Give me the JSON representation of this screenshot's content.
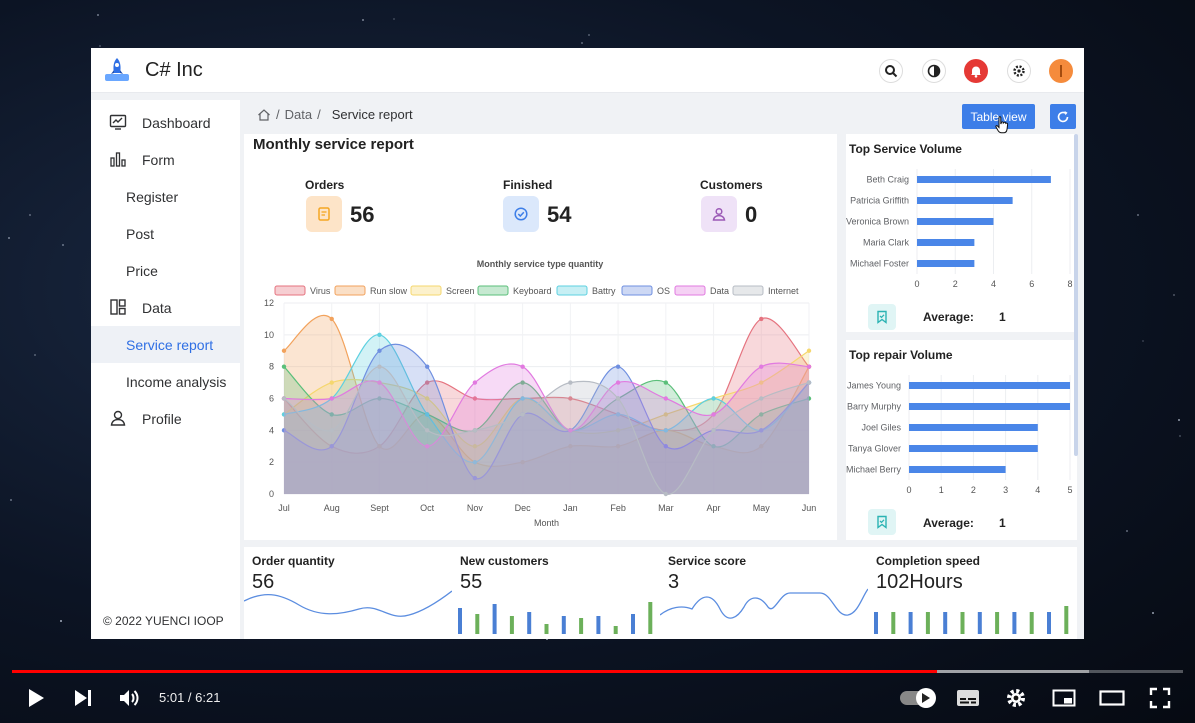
{
  "app": {
    "brand": "C# Inc",
    "accent": "#3d7ee8"
  },
  "topbar": {
    "icons": [
      "search-icon",
      "theme-toggle-icon",
      "notification-bell-icon",
      "gear-icon",
      "user-avatar"
    ]
  },
  "sidebar": {
    "items": [
      {
        "label": "Dashboard",
        "icon": "monitor-chart-icon"
      },
      {
        "label": "Form",
        "icon": "bar-chart-icon"
      },
      {
        "label": "Register"
      },
      {
        "label": "Post"
      },
      {
        "label": "Price"
      },
      {
        "label": "Data",
        "icon": "layout-grid-icon"
      },
      {
        "label": "Service report",
        "active": true
      },
      {
        "label": "Income analysis"
      },
      {
        "label": "Profile",
        "icon": "user-icon"
      }
    ],
    "copyright": "© 2022 YUENCI IOOP"
  },
  "breadcrumb": {
    "home_icon": "home-icon",
    "items": [
      "Data",
      "Service report"
    ]
  },
  "toolbar": {
    "table_view": "Table view",
    "refresh_icon": "refresh-icon"
  },
  "report": {
    "title": "Monthly service report",
    "kpis": [
      {
        "label": "Orders",
        "value": "56",
        "icon": "document-icon",
        "color": "#f5a623"
      },
      {
        "label": "Finished",
        "value": "54",
        "icon": "check-circle-icon",
        "color": "#3d7ee8"
      },
      {
        "label": "Customers",
        "value": "0",
        "icon": "user-icon",
        "color": "#9b59b6"
      }
    ]
  },
  "chart_data": [
    {
      "type": "area",
      "title": "Monthly service type quantity",
      "xlabel": "Month",
      "ylabel": "",
      "ylim": [
        0,
        12
      ],
      "yticks": [
        0,
        2,
        4,
        6,
        8,
        10,
        12
      ],
      "legend_position": "top",
      "categories": [
        "Jul",
        "Aug",
        "Sept",
        "Oct",
        "Nov",
        "Dec",
        "Jan",
        "Feb",
        "Mar",
        "Apr",
        "May",
        "Jun"
      ],
      "series": [
        {
          "name": "Virus",
          "color": "#e5737f",
          "values": [
            6,
            3,
            3,
            7,
            6,
            6,
            6,
            5,
            4,
            5,
            11,
            8
          ]
        },
        {
          "name": "Run slow",
          "color": "#f2a25c",
          "values": [
            9,
            11,
            3,
            5,
            2,
            2,
            3,
            3,
            4,
            3,
            3,
            8
          ]
        },
        {
          "name": "Screen",
          "color": "#f5d76e",
          "values": [
            5,
            7,
            7,
            6,
            3,
            6,
            4,
            4,
            5,
            6,
            7,
            9
          ]
        },
        {
          "name": "Keyboard",
          "color": "#5bbf7a",
          "values": [
            8,
            5,
            6,
            5,
            4,
            7,
            4,
            6,
            7,
            3,
            5,
            6
          ]
        },
        {
          "name": "Battry",
          "color": "#5ed0e0",
          "values": [
            5,
            6,
            10,
            5,
            2,
            6,
            4,
            5,
            4,
            6,
            4,
            7
          ]
        },
        {
          "name": "OS",
          "color": "#6f8fe0",
          "values": [
            4,
            3,
            9,
            8,
            1,
            5,
            4,
            8,
            3,
            4,
            4,
            7
          ]
        },
        {
          "name": "Data",
          "color": "#e17ae0",
          "values": [
            6,
            6,
            7,
            3,
            7,
            8,
            4,
            7,
            6,
            5,
            8,
            8
          ]
        },
        {
          "name": "Internet",
          "color": "#b7bcc4",
          "values": [
            6,
            4,
            8,
            4,
            4,
            5,
            7,
            6,
            0,
            4,
            6,
            7
          ]
        }
      ]
    },
    {
      "type": "bar",
      "orientation": "horizontal",
      "title": "Top Service Volume",
      "categories": [
        "Beth Craig",
        "Patricia Griffith",
        "Veronica Brown",
        "Maria Clark",
        "Michael Foster"
      ],
      "values": [
        7,
        5,
        4,
        3,
        3
      ],
      "xlim": [
        0,
        8
      ],
      "xticks": [
        0,
        2,
        4,
        6,
        8
      ],
      "color": "#4a86e8"
    },
    {
      "type": "bar",
      "orientation": "horizontal",
      "title": "Top repair Volume",
      "categories": [
        "James Young",
        "Barry Murphy",
        "Joel Giles",
        "Tanya Glover",
        "Michael Berry"
      ],
      "values": [
        5,
        5,
        4,
        4,
        3
      ],
      "xlim": [
        0,
        5
      ],
      "xticks": [
        0,
        1,
        2,
        3,
        4,
        5
      ],
      "color": "#4a86e8"
    }
  ],
  "service_volume": {
    "average_label": "Average:",
    "average_value": "1",
    "icon": "bookmark-icon"
  },
  "repair_volume": {
    "average_label": "Average:",
    "average_value": "1",
    "icon": "bookmark-icon"
  },
  "stats": [
    {
      "label": "Order quantity",
      "value": "56",
      "spark": "line"
    },
    {
      "label": "New customers",
      "value": "55",
      "spark": "bars"
    },
    {
      "label": "Service score",
      "value": "3",
      "spark": "line"
    },
    {
      "label": "Completion speed",
      "value": "102Hours",
      "spark": "bars"
    }
  ],
  "player": {
    "time": "5:01 / 6:21",
    "progress": 0.79,
    "buffered": 0.92,
    "controls": [
      "play-icon",
      "next-icon",
      "volume-icon",
      "autoplay-toggle",
      "subtitles-icon",
      "settings-icon",
      "miniplayer-icon",
      "theater-mode-icon",
      "fullscreen-icon"
    ]
  }
}
